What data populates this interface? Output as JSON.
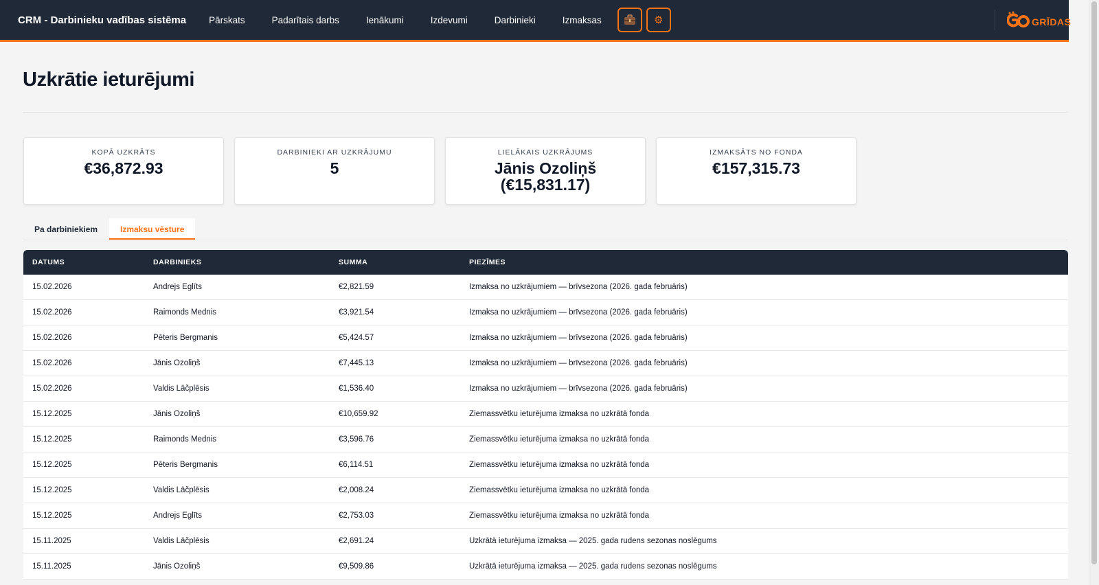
{
  "header": {
    "brand": "CRM - Darbinieku vadības sistēma",
    "nav": [
      "Pārskats",
      "Padarītais darbs",
      "Ienākumi",
      "Izdevumi",
      "Darbinieki",
      "Izmaksas"
    ],
    "icon_buttons": [
      "briefcase-icon",
      "gear-icon"
    ],
    "logo_text": "GRĪDAS",
    "accent_color": "#f97316",
    "bar_color": "#1f2937"
  },
  "page": {
    "title": "Uzkrātie ieturējumi"
  },
  "stats": [
    {
      "label": "KOPĀ UZKRĀTS",
      "value": "€36,872.93"
    },
    {
      "label": "DARBINIEKI AR UZKRĀJUMU",
      "value": "5"
    },
    {
      "label": "LIELĀKAIS UZKRĀJUMS",
      "value": "Jānis Ozoliņš (€15,831.17)"
    },
    {
      "label": "IZMAKSĀTS NO FONDA",
      "value": "€157,315.73"
    }
  ],
  "tabs": {
    "by_employee": "Pa darbiniekiem",
    "payout_history": "Izmaksu vēsture",
    "active": "payout_history"
  },
  "table": {
    "columns": [
      "DATUMS",
      "DARBINIEKS",
      "SUMMA",
      "PIEZĪMES"
    ],
    "rows": [
      [
        "15.02.2026",
        "Andrejs Eglīts",
        "€2,821.59",
        "Izmaksa no uzkrājumiem — brīvsezona (2026. gada februāris)"
      ],
      [
        "15.02.2026",
        "Raimonds Mednis",
        "€3,921.54",
        "Izmaksa no uzkrājumiem — brīvsezona (2026. gada februāris)"
      ],
      [
        "15.02.2026",
        "Pēteris Bergmanis",
        "€5,424.57",
        "Izmaksa no uzkrājumiem — brīvsezona (2026. gada februāris)"
      ],
      [
        "15.02.2026",
        "Jānis Ozoliņš",
        "€7,445.13",
        "Izmaksa no uzkrājumiem — brīvsezona (2026. gada februāris)"
      ],
      [
        "15.02.2026",
        "Valdis Lāčplēsis",
        "€1,536.40",
        "Izmaksa no uzkrājumiem — brīvsezona (2026. gada februāris)"
      ],
      [
        "15.12.2025",
        "Jānis Ozoliņš",
        "€10,659.92",
        "Ziemassvētku ieturējuma izmaksa no uzkrātā fonda"
      ],
      [
        "15.12.2025",
        "Raimonds Mednis",
        "€3,596.76",
        "Ziemassvētku ieturējuma izmaksa no uzkrātā fonda"
      ],
      [
        "15.12.2025",
        "Pēteris Bergmanis",
        "€6,114.51",
        "Ziemassvētku ieturējuma izmaksa no uzkrātā fonda"
      ],
      [
        "15.12.2025",
        "Valdis Lāčplēsis",
        "€2,008.24",
        "Ziemassvētku ieturējuma izmaksa no uzkrātā fonda"
      ],
      [
        "15.12.2025",
        "Andrejs Eglīts",
        "€2,753.03",
        "Ziemassvētku ieturējuma izmaksa no uzkrātā fonda"
      ],
      [
        "15.11.2025",
        "Valdis Lāčplēsis",
        "€2,691.24",
        "Uzkrātā ieturējuma izmaksa — 2025. gada rudens sezonas noslēgums"
      ],
      [
        "15.11.2025",
        "Jānis Ozoliņš",
        "€9,509.86",
        "Uzkrātā ieturējuma izmaksa — 2025. gada rudens sezonas noslēgums"
      ]
    ]
  }
}
